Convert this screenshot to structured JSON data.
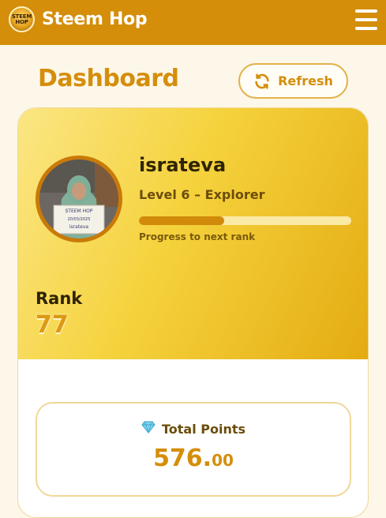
{
  "header": {
    "logo_text": "STEEM HOP",
    "app_title": "Steem Hop",
    "menu_icon": "hamburger-menu-icon",
    "bar_color": "#d48e0a"
  },
  "dashboard": {
    "title": "Dashboard",
    "refresh_label": "Refresh",
    "refresh_icon": "refresh-icon",
    "accent_color": "#d58e0b"
  },
  "profile": {
    "username": "israteva",
    "level_text": "Level 6 – Explorer",
    "progress_fraction": 0.4,
    "progress_caption": "Progress to next rank",
    "rank_label": "Rank",
    "rank_value": "77",
    "avatar_sign_lines": [
      "STEEM HOP",
      "20/03/2025",
      "israteva"
    ]
  },
  "points": {
    "icon": "diamond-icon",
    "label": "Total Points",
    "value_integer": "576.",
    "value_decimals": "00"
  }
}
